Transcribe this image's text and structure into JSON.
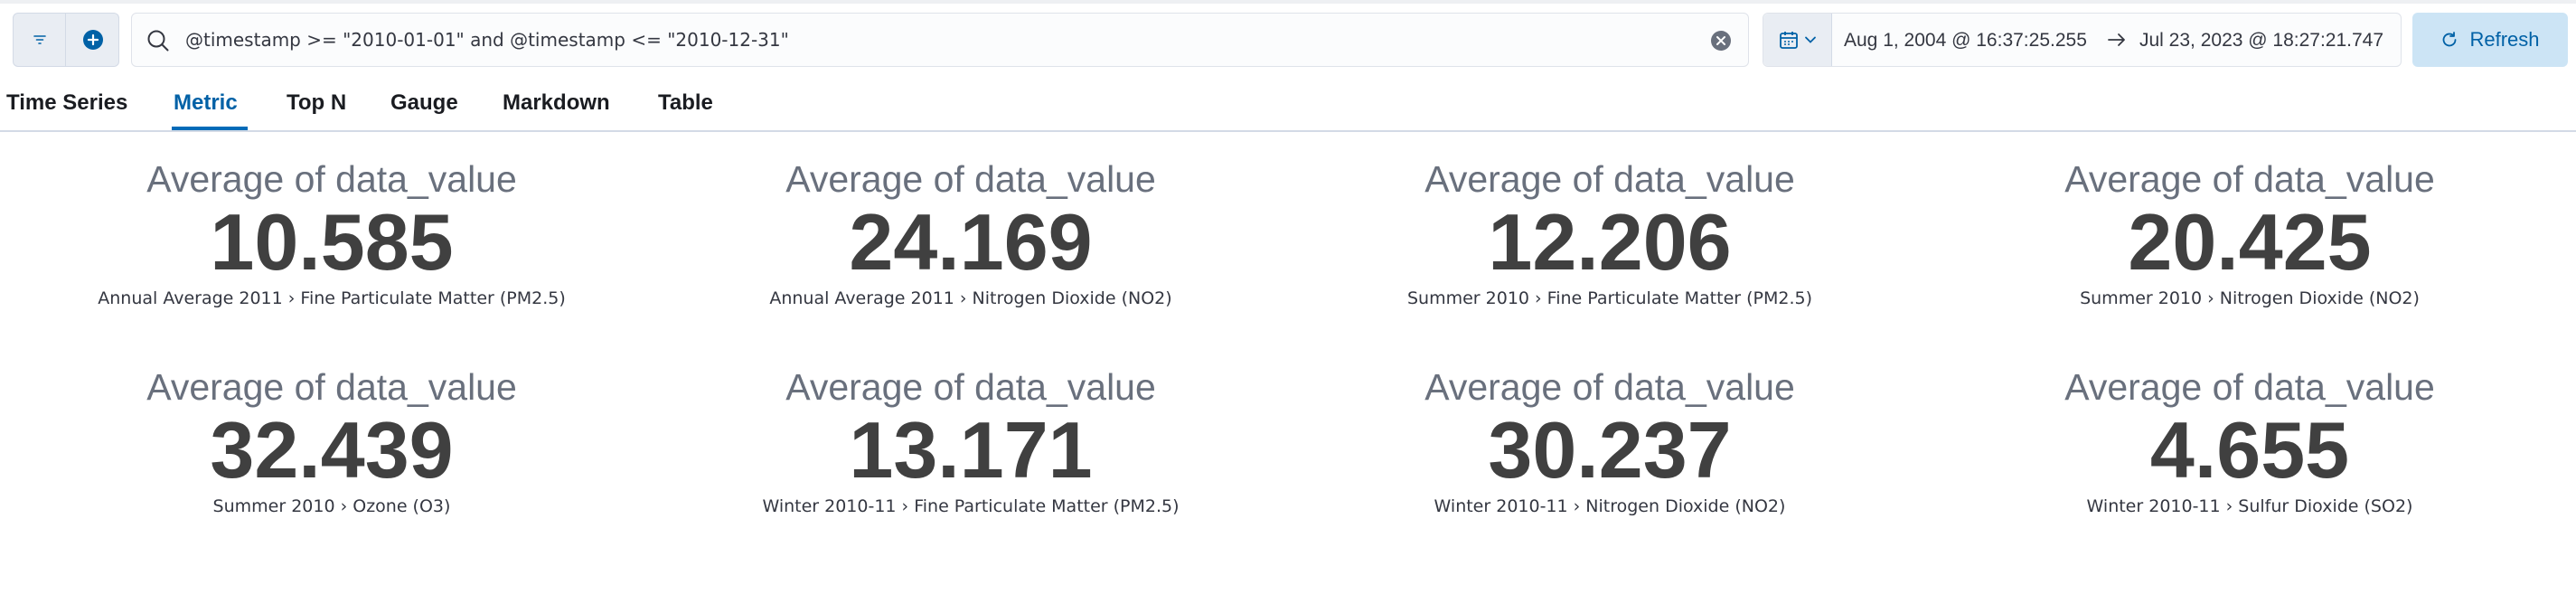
{
  "query_bar": {
    "query": "@timestamp >= \"2010-01-01\" and @timestamp <= \"2010-12-31\""
  },
  "date_picker": {
    "start": "Aug 1, 2004 @ 16:37:25.255",
    "end": "Jul 23, 2023 @ 18:27:21.747"
  },
  "refresh_label": "Refresh",
  "tabs": [
    {
      "label": "Time Series",
      "active": false
    },
    {
      "label": "Metric",
      "active": true
    },
    {
      "label": "Top N",
      "active": false
    },
    {
      "label": "Gauge",
      "active": false
    },
    {
      "label": "Markdown",
      "active": false
    },
    {
      "label": "Table",
      "active": false
    }
  ],
  "metrics": [
    {
      "label": "Average of data_value",
      "value": "10.585",
      "sublabel": "Annual Average 2011 › Fine Particulate Matter (PM2.5)"
    },
    {
      "label": "Average of data_value",
      "value": "24.169",
      "sublabel": "Annual Average 2011 › Nitrogen Dioxide (NO2)"
    },
    {
      "label": "Average of data_value",
      "value": "12.206",
      "sublabel": "Summer 2010 › Fine Particulate Matter (PM2.5)"
    },
    {
      "label": "Average of data_value",
      "value": "20.425",
      "sublabel": "Summer 2010 › Nitrogen Dioxide (NO2)"
    },
    {
      "label": "Average of data_value",
      "value": "32.439",
      "sublabel": "Summer 2010 › Ozone (O3)"
    },
    {
      "label": "Average of data_value",
      "value": "13.171",
      "sublabel": "Winter 2010-11 › Fine Particulate Matter (PM2.5)"
    },
    {
      "label": "Average of data_value",
      "value": "30.237",
      "sublabel": "Winter 2010-11 › Nitrogen Dioxide (NO2)"
    },
    {
      "label": "Average of data_value",
      "value": "4.655",
      "sublabel": "Winter 2010-11 › Sulfur Dioxide (SO2)"
    }
  ],
  "colors": {
    "accent": "#006bb8",
    "metric_value": "#404040",
    "metric_label": "#69707d",
    "refresh_bg": "#cce4f5"
  },
  "icons": [
    "filter-icon",
    "add-filter-icon",
    "search-icon",
    "clear-icon",
    "calendar-icon",
    "chevron-down-icon",
    "arrow-right-icon",
    "refresh-icon"
  ]
}
